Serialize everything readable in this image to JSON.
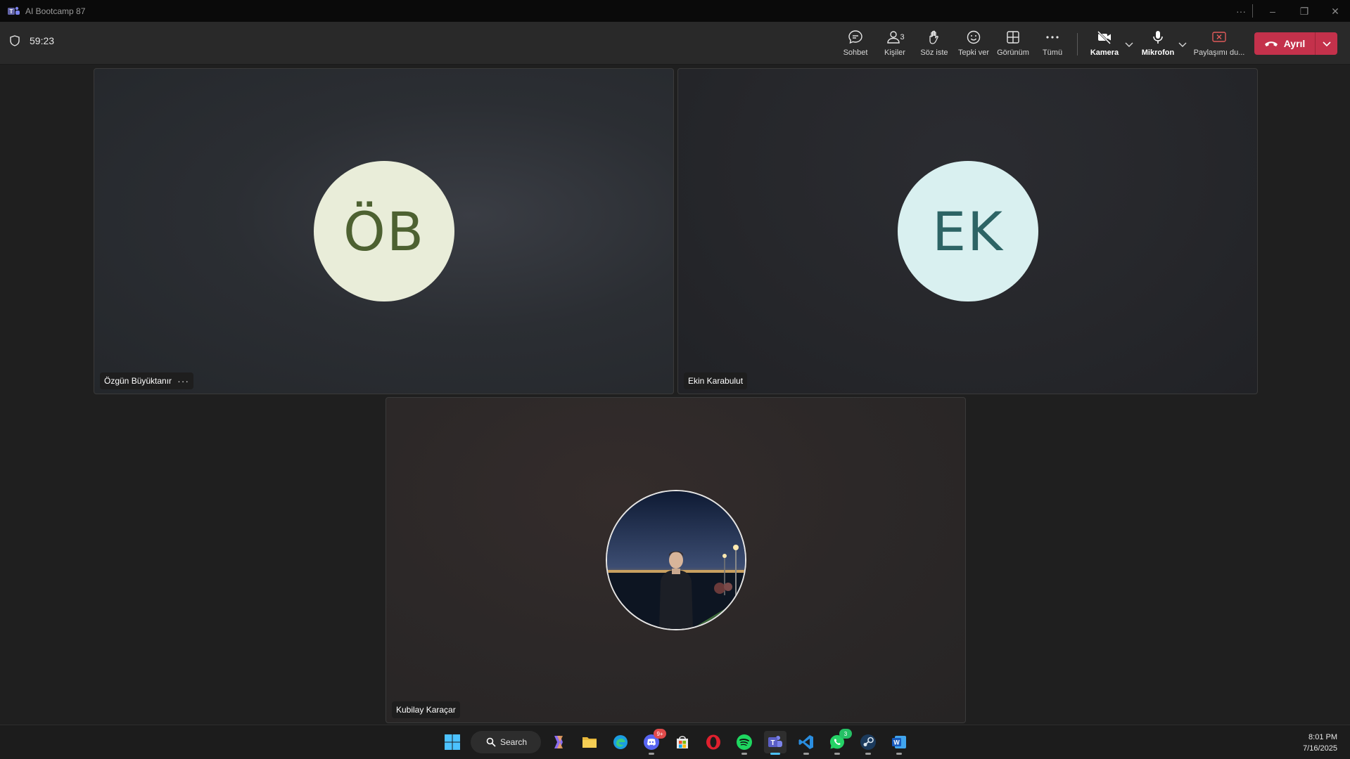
{
  "window": {
    "title": "AI Bootcamp 87"
  },
  "meeting": {
    "timer": "59:23",
    "toolbar": {
      "chat": "Sohbet",
      "people": "Kişiler",
      "people_count": "3",
      "raise_hand": "Söz iste",
      "react": "Tepki ver",
      "view": "Görünüm",
      "more": "Tümü",
      "camera": "Kamera",
      "mic": "Mikrofon",
      "share": "Paylaşımı du...",
      "leave": "Ayrıl"
    },
    "participants": [
      {
        "initials": "ÖB",
        "name": "Özgün Büyüktanır",
        "more": "···"
      },
      {
        "initials": "EK",
        "name": "Ekin Karabulut"
      },
      {
        "name": "Kubilay Karaçar"
      }
    ]
  },
  "taskbar": {
    "search": "Search",
    "discord_badge": "9+",
    "whatsapp_badge": "3",
    "time": "8:01 PM",
    "date": "7/16/2025"
  },
  "colors": {
    "leave_button": "#c4314b",
    "teams_purple": "#6264a7",
    "avatar_ob_bg": "#e9edd9",
    "avatar_ek_bg": "#d9f0f0"
  }
}
